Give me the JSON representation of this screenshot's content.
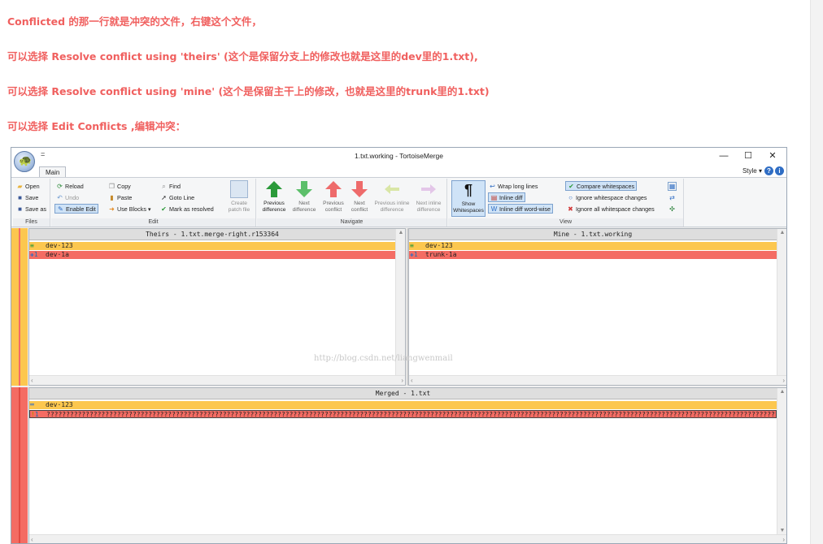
{
  "notes": [
    "Conflicted 的那一行就是冲突的文件，右键这个文件，",
    "可以选择 Resolve conflict using 'theirs' (这个是保留分支上的修改也就是这里的dev里的1.txt),",
    "可以选择 Resolve conflict using 'mine' (这个是保留主干上的修改，也就是这里的trunk里的1.txt)",
    "可以选择 Edit Conflicts ,编辑冲突："
  ],
  "window": {
    "title": "1.txt.working - TortoiseMerge",
    "qat": "=",
    "minimize": "—",
    "maximize": "☐",
    "close": "✕",
    "tab_main": "Main",
    "style_menu": "Style ▾",
    "help": "?",
    "info": "i"
  },
  "ribbon": {
    "files": {
      "label": "Files",
      "open": "Open",
      "save": "Save",
      "save_as": "Save as"
    },
    "edit": {
      "label": "Edit",
      "reload": "Reload",
      "undo": "Undo",
      "enable_edit": "Enable Edit",
      "copy": "Copy",
      "paste": "Paste",
      "use_blocks": "Use Blocks ▾",
      "find": "Find",
      "goto_line": "Goto Line",
      "mark_resolved": "Mark as resolved",
      "create_patch": "Create\npatch file"
    },
    "navigate": {
      "label": "Navigate",
      "prev_diff": "Previous\ndifference",
      "next_diff": "Next\ndifference",
      "prev_conflict": "Previous\nconflict",
      "next_conflict": "Next\nconflict",
      "prev_inline": "Previous inline\ndifference",
      "next_inline": "Next inline\ndifference"
    },
    "view": {
      "label": "View",
      "show_ws": "Show\nWhitespaces",
      "wrap": "Wrap long lines",
      "inline_diff": "Inline diff",
      "inline_word": "Inline diff word-wise",
      "compare_ws": "Compare whitespaces",
      "ignore_changes": "Ignore whitespace changes",
      "ignore_all": "Ignore all whitespace changes"
    }
  },
  "theirs": {
    "title": "Theirs - 1.txt.merge-right.r153364",
    "lines": [
      {
        "num": "",
        "marker": "≡",
        "text": "dev·123",
        "style": "yellow"
      },
      {
        "num": "1",
        "marker": "✚",
        "text": "dev·1a",
        "style": "red"
      }
    ]
  },
  "mine": {
    "title": "Mine - 1.txt.working",
    "lines": [
      {
        "num": "",
        "marker": "≡",
        "text": "dev·123",
        "style": "yellow"
      },
      {
        "num": "1",
        "marker": "✚",
        "text": "trunk·1a",
        "style": "red"
      }
    ]
  },
  "merged": {
    "title": "Merged - 1.txt",
    "lines": [
      {
        "num": "",
        "marker": "═",
        "text": "dev·123",
        "style": "yellow"
      },
      {
        "num": "1",
        "marker": "!",
        "text": "????????????????????????????????????????????????????????????????????????????????????????????????????????????????????????????????????????????????????????????????????????????????????????????????????????????????",
        "style": "red"
      }
    ]
  },
  "watermark": "http://blog.csdn.net/liangwenmail",
  "colors": {
    "note": "#f0605f",
    "conflict_yellow": "#fcc74f",
    "conflict_red": "#f46c63"
  }
}
